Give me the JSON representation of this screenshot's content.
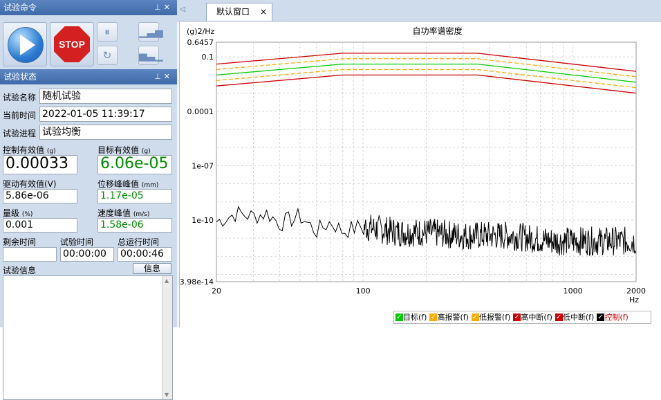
{
  "panels": {
    "command_title": "试验命令",
    "status_title": "试验状态",
    "pin_icon": "pin-icon",
    "close_icon": "close-icon"
  },
  "commands": {
    "play_icon": "play-icon",
    "stop_label": "STOP",
    "pause_icon": "pause-icon",
    "bars_up_icon": "level-up-icon",
    "redo_icon": "refresh-arrow-icon",
    "bars_down_icon": "level-down-icon"
  },
  "status": {
    "name_label": "试验名称",
    "name_value": "随机试验",
    "time_label": "当前时间",
    "time_value": "2022-01-05 11:39:17",
    "progress_label": "试验进程",
    "progress_value": "试验均衡",
    "ctrl_rms_label": "控制有效值",
    "ctrl_rms_unit": "(g)",
    "ctrl_rms_value": "0.00033",
    "target_rms_label": "目标有效值",
    "target_rms_unit": "(g)",
    "target_rms_value": "6.06e-05",
    "drive_rms_label": "驱动有效值(V)",
    "drive_rms_value": "5.86e-06",
    "disp_label": "位移峰峰值",
    "disp_unit": "(mm)",
    "disp_value": "1.17e-05",
    "level_label": "量级",
    "level_unit": "(%)",
    "level_value": "0.001",
    "vel_label": "速度峰值",
    "vel_unit": "(m/s)",
    "vel_value": "1.58e-06",
    "remain_label": "剩余时间",
    "remain_value": "",
    "test_time_label": "试验时间",
    "test_time_value": "00:00:00",
    "total_time_label": "总运行时间",
    "total_time_value": "00:00:46",
    "info_label": "试验信息",
    "info_button": "信息"
  },
  "tabs": {
    "active": "默认窗口",
    "close": "×"
  },
  "colors": {
    "target": "#00cc00",
    "high_alarm": "#ffaa00",
    "low_alarm": "#ffaa00",
    "high_abort": "#cc0000",
    "low_abort": "#cc0000",
    "control": "#000000"
  },
  "chart_data": {
    "type": "line",
    "title": "自功率谱密度",
    "ylabel": "(g)2/Hz",
    "xlabel": "Hz",
    "xscale": "log",
    "yscale": "log",
    "xlim": [
      20,
      2000
    ],
    "ylim": [
      3.98e-14,
      0.6457
    ],
    "xticks": [
      "20",
      "100",
      "1000",
      "2000"
    ],
    "yticks": [
      "0.6457",
      "0.1",
      "0.0001",
      "1e-07",
      "1e-10",
      "3.98e-14"
    ],
    "grid": true,
    "series": [
      {
        "name": "目标(f)",
        "color": "#00cc00",
        "dash": false,
        "x": [
          20,
          80,
          350,
          2000
        ],
        "y": [
          0.01,
          0.04,
          0.04,
          0.004
        ]
      },
      {
        "name": "高报警(f)",
        "color": "#ffaa00",
        "dash": true,
        "x": [
          20,
          80,
          350,
          2000
        ],
        "y": [
          0.02,
          0.08,
          0.08,
          0.008
        ]
      },
      {
        "name": "低报警(f)",
        "color": "#ffaa00",
        "dash": true,
        "x": [
          20,
          80,
          350,
          2000
        ],
        "y": [
          0.005,
          0.02,
          0.02,
          0.002
        ]
      },
      {
        "name": "高中断(f)",
        "color": "#cc0000",
        "dash": false,
        "x": [
          20,
          80,
          350,
          2000
        ],
        "y": [
          0.04,
          0.16,
          0.16,
          0.016
        ]
      },
      {
        "name": "低中断(f)",
        "color": "#cc0000",
        "dash": false,
        "x": [
          20,
          80,
          350,
          2000
        ],
        "y": [
          0.0025,
          0.01,
          0.01,
          0.001
        ]
      },
      {
        "name": "控制(f)",
        "color": "#000000",
        "dash": false,
        "noisy": true,
        "x": [
          20,
          25,
          30,
          35,
          40,
          50,
          60,
          70,
          80,
          100,
          150,
          200,
          300,
          500,
          800,
          1200,
          2000
        ],
        "y": [
          1e-10,
          3e-10,
          2e-10,
          3e-10,
          8e-11,
          2e-10,
          3e-11,
          1e-10,
          3e-11,
          6e-11,
          3e-11,
          3e-11,
          2e-11,
          2e-11,
          1e-11,
          1e-11,
          1e-11
        ]
      }
    ],
    "legend": [
      "目标(f)",
      "高报警(f)",
      "低报警(f)",
      "高中断(f)",
      "低中断(f)",
      "控制(f)"
    ],
    "legend_position": "bottom"
  }
}
